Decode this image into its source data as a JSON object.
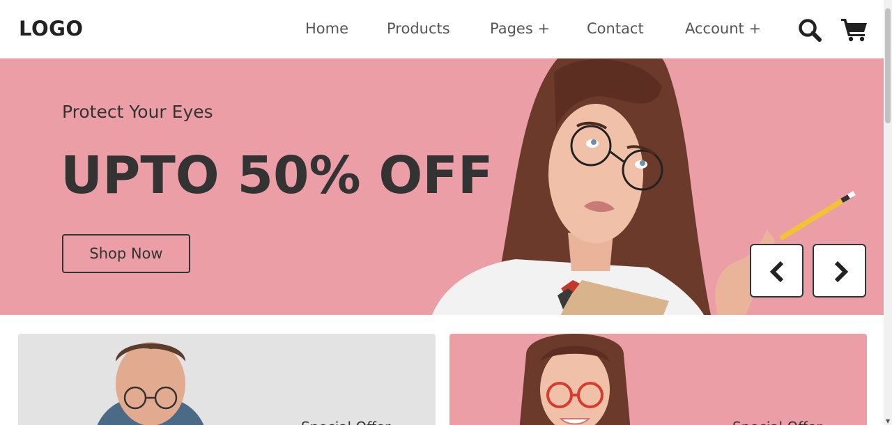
{
  "header": {
    "logo": "LOGO",
    "nav": {
      "home": "Home",
      "products": "Products",
      "pages": "Pages +",
      "contact": "Contact",
      "account": "Account +"
    },
    "icons": {
      "search": "search-icon",
      "cart": "cart-icon"
    }
  },
  "hero": {
    "subtitle": "Protect Your Eyes",
    "title": "UPTO 50% OFF",
    "cta": "Shop Now",
    "background": "#ec9ea7",
    "icons": {
      "prev": "chevron-left-icon",
      "next": "chevron-right-icon"
    }
  },
  "cards": [
    {
      "tag": "Special Offer",
      "background": "#e3e3e3"
    },
    {
      "tag": "Special Offer",
      "background": "#ec9ea7"
    }
  ],
  "colors": {
    "text": "#333333",
    "pink": "#ec9ea7",
    "grey": "#e3e3e3"
  }
}
